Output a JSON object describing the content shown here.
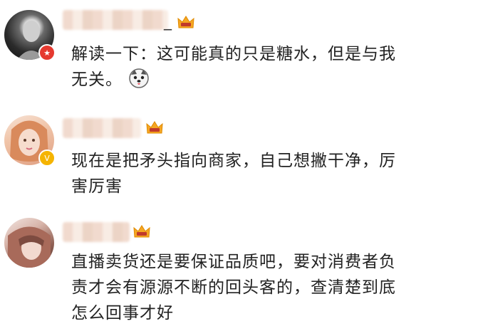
{
  "comments": [
    {
      "name_suffix": "_",
      "badge_icon": "star-badge-icon",
      "lines": [
        "解读一下：这可能真的只是糖水，但是与我",
        "无关。"
      ],
      "emoji": "husky-emoji-icon"
    },
    {
      "name_suffix": "",
      "badge_icon": "verified-badge-icon",
      "lines": [
        "现在是把矛头指向商家，自己想撇干净，厉",
        "害厉害"
      ]
    },
    {
      "name_suffix": "",
      "badge_icon": "",
      "lines": [
        "直播卖货还是要保证品质吧，要对消费者负",
        "责才会有源源不断的回头客的，查清楚到底",
        "怎么回事才好"
      ]
    }
  ],
  "colors": {
    "crown": "#f5a623",
    "star_badge": "#e5392f",
    "verified_badge": "#f5b400",
    "text": "#222222"
  }
}
